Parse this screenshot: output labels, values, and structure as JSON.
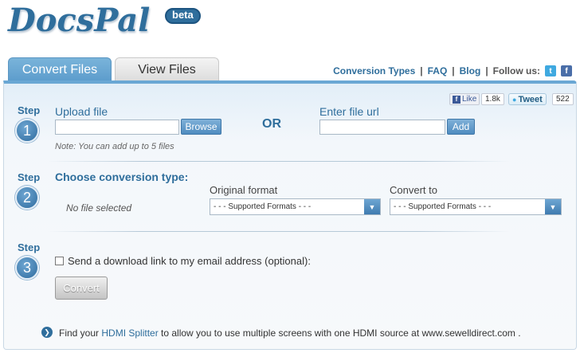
{
  "logo": {
    "name": "DocsPal",
    "badge": "beta"
  },
  "tabs": {
    "convert": "Convert Files",
    "view": "View Files"
  },
  "topnav": {
    "items": [
      "Conversion Types",
      "FAQ",
      "Blog"
    ],
    "separator": "|",
    "follow_label": "Follow us:",
    "icons": [
      "twitter-icon",
      "facebook-icon"
    ]
  },
  "social": {
    "like_label": "Like",
    "like_count": "1.8k",
    "tweet_label": "Tweet",
    "tweet_count": "522"
  },
  "steps": [
    {
      "word": "Step",
      "number": "1"
    },
    {
      "word": "Step",
      "number": "2"
    },
    {
      "word": "Step",
      "number": "3"
    }
  ],
  "upload": {
    "label": "Upload file",
    "value": "",
    "browse_label": "Browse",
    "note": "Note: You can add up to 5 files",
    "or_text": "OR",
    "url_label": "Enter file url",
    "url_value": "",
    "add_label": "Add"
  },
  "conversion": {
    "heading": "Choose conversion type:",
    "no_file": "No file selected",
    "original_label": "Original format",
    "original_selected": "- - - Supported Formats - - -",
    "convert_label": "Convert to",
    "convert_selected": "- - - Supported Formats - - -"
  },
  "email": {
    "checkbox_label": "Send a download link to my email address (optional):",
    "checked": false,
    "convert_label": "Convert"
  },
  "promo": {
    "prefix": "Find your ",
    "link": "HDMI Splitter",
    "suffix": " to allow you to use multiple screens with one HDMI source at www.sewelldirect.com ."
  },
  "colors": {
    "accent": "#2f6e9c",
    "tab_active": "#5c9ccc",
    "panel_top": "#e2eef8"
  }
}
